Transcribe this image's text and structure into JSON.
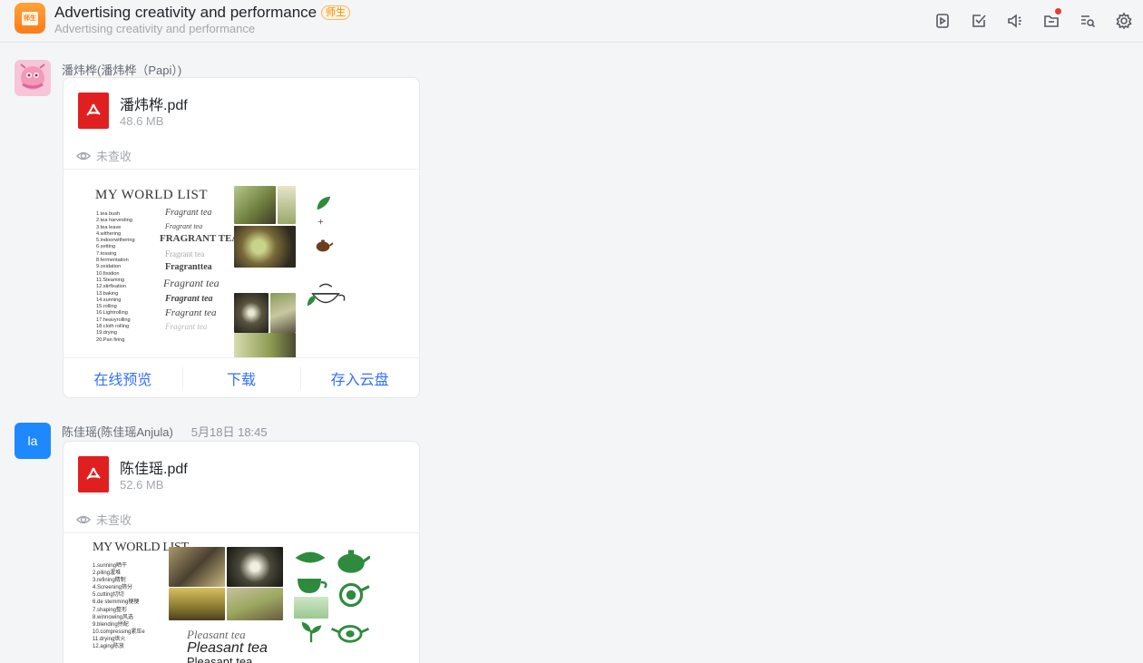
{
  "header": {
    "app_icon_text": "师生",
    "title": "Advertising creativity and performance",
    "badge": "师生",
    "subtitle": "Advertising creativity and performance",
    "tools": [
      "video-icon",
      "task-check-icon",
      "announcement-icon",
      "folder-icon",
      "search-history-icon",
      "settings-icon"
    ]
  },
  "messages": [
    {
      "sender": "潘炜桦(潘炜桦（Papi）)",
      "time": "",
      "file": {
        "name": "潘炜桦.pdf",
        "size": "48.6 MB",
        "status": "未查收"
      },
      "preview": {
        "title": "MY WORLD LIST",
        "list": "1.tea bush\n2.tea harvesting\n3.tea leave\n4.withering\n5.indoorwithering\n6.setting\n7.tossing\n8.fermentation\n9.oxidation\n10.fixation\n11.Steaming\n12.stirfixation\n13.baking\n14.sunning\n15.rolling\n16.Lightrolling\n17.heavyrolling\n18.cloth rolling\n19.drying\n20.Pan firing",
        "font_samples": [
          "Fragrant tea",
          "Fragrant tea",
          "FRAGRANT TEA",
          "Fragrant tea",
          "Fragranttea",
          "Fragrant tea",
          "Fragrant tea",
          "Fragrant tea",
          "Fragrant tea"
        ],
        "plus": "+"
      },
      "actions": [
        "在线预览",
        "下载",
        "存入云盘"
      ]
    },
    {
      "sender": "陈佳瑶(陈佳瑶Anjula)",
      "time": "5月18日 18:45",
      "avatar_text": "la",
      "file": {
        "name": "陈佳瑶.pdf",
        "size": "52.6 MB",
        "status": "未查收"
      },
      "preview": {
        "title": "MY WORLD LIST",
        "list": "1.sunning晒干\n2.piling渥堆\n3.refining精制\n4.Screening筛分\n5.cutting切切\n6.de stemming梗梗\n7.shaping整形\n8.winnowing风选\n9.blending拼配\n10.compressing紧压e\n11.drying烘火\n12.aging陈放",
        "font_samples": [
          "Pleasant tea",
          "Pleasant tea",
          "Pleasant tea"
        ]
      }
    }
  ],
  "colors": {
    "accent": "#3370ff",
    "pdf": "#e02020",
    "badge": "#f08a00",
    "tea_green": "#2e8b3e"
  }
}
